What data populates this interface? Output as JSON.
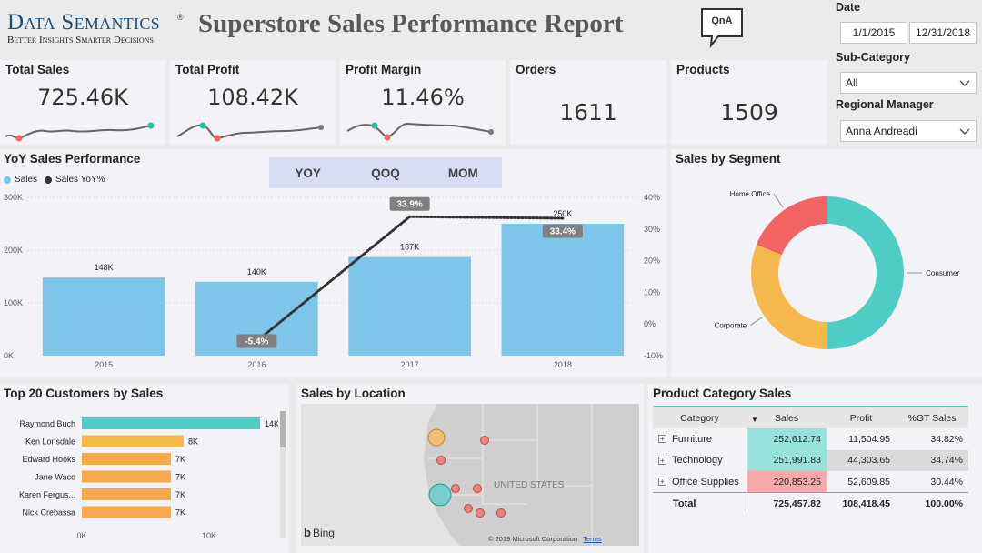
{
  "header": {
    "brand_name": "Data Semantics",
    "brand_tagline": "Better Insights Smarter Decisions",
    "title": "Superstore Sales Performance Report",
    "qna_label": "QnA"
  },
  "kpis": [
    {
      "title": "Total Sales",
      "value": "725.46K"
    },
    {
      "title": "Total Profit",
      "value": "108.42K"
    },
    {
      "title": "Profit Margin",
      "value": "11.46%"
    },
    {
      "title": "Orders",
      "value": "1611"
    },
    {
      "title": "Products",
      "value": "1509"
    }
  ],
  "filters": {
    "date_label": "Date",
    "date_start": "1/1/2015",
    "date_end": "12/31/2018",
    "subcategory_label": "Sub-Category",
    "subcategory_value": "All",
    "manager_label": "Regional Manager",
    "manager_value": "Anna Andreadi"
  },
  "yoy": {
    "title": "YoY Sales Performance",
    "legend": [
      "Sales",
      "Sales YoY%"
    ],
    "toggle": [
      "YOY",
      "QOQ",
      "MOM"
    ],
    "y_left_ticks": [
      "0K",
      "100K",
      "200K",
      "300K"
    ],
    "y_right_ticks": [
      "-10%",
      "0%",
      "10%",
      "20%",
      "30%",
      "40%"
    ]
  },
  "segment": {
    "title": "Sales by Segment"
  },
  "customers": {
    "title": "Top 20 Customers by Sales",
    "x_ticks": [
      "0K",
      "10K"
    ]
  },
  "location": {
    "title": "Sales by Location",
    "country_label": "UNITED STATES",
    "bing_label": "Bing",
    "copyright": "© 2019 Microsoft Corporation",
    "terms": "Terms"
  },
  "category": {
    "title": "Product Category Sales",
    "columns": [
      "Category",
      "Sales",
      "Profit",
      "%GT Sales"
    ],
    "rows": [
      {
        "name": "Furniture",
        "sales": "252,612.74",
        "profit": "11,504.95",
        "pct": "34.82%"
      },
      {
        "name": "Technology",
        "sales": "251,991.83",
        "profit": "44,303.65",
        "pct": "34.74%"
      },
      {
        "name": "Office Supplies",
        "sales": "220,853.25",
        "profit": "52,609.85",
        "pct": "30.44%"
      }
    ],
    "total": {
      "name": "Total",
      "sales": "725,457.82",
      "profit": "108,418.45",
      "pct": "100.00%"
    }
  },
  "colors": {
    "bar_blue": "#7dc6ea",
    "teal": "#4ecdc4",
    "yellow": "#f5b94b",
    "orange": "#f7a84c",
    "red": "#f36363",
    "dark": "#333333"
  },
  "chart_data": [
    {
      "type": "bar",
      "categories": [
        "2015",
        "2016",
        "2017",
        "2018"
      ],
      "series": [
        {
          "name": "Sales",
          "values": [
            148,
            140,
            187,
            250
          ],
          "labels": [
            "148K",
            "140K",
            "187K",
            "250K"
          ]
        },
        {
          "name": "Sales YoY%",
          "values": [
            null,
            -5.4,
            33.9,
            33.4
          ],
          "labels": [
            "",
            "-5.4%",
            "33.9%",
            "33.4%"
          ]
        }
      ],
      "title": "YoY Sales Performance",
      "ylim": [
        0,
        300
      ],
      "y2lim": [
        -10,
        40
      ],
      "legend": "top-left"
    },
    {
      "type": "pie",
      "categories": [
        "Consumer",
        "Corporate",
        "Home Office"
      ],
      "values": [
        50,
        31,
        19
      ],
      "title": "Sales by Segment"
    },
    {
      "type": "bar",
      "orientation": "horizontal",
      "categories": [
        "Raymond Buch",
        "Ken Lonsdale",
        "Edward Hooks",
        "Jane Waco",
        "Karen Fergus...",
        "Nick Crebassa"
      ],
      "values": [
        14,
        8,
        7,
        7,
        7,
        7
      ],
      "labels": [
        "14K",
        "8K",
        "7K",
        "7K",
        "7K",
        "7K"
      ],
      "title": "Top 20 Customers by Sales",
      "xlim": [
        0,
        15
      ]
    }
  ]
}
